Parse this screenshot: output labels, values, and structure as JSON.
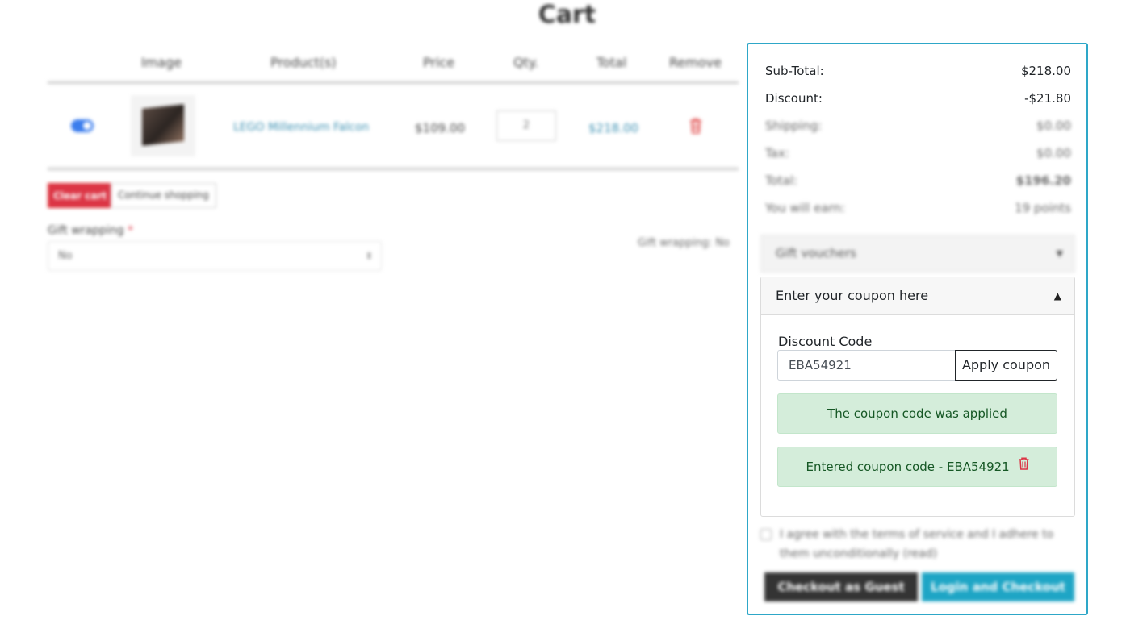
{
  "page": {
    "title": "Cart"
  },
  "table": {
    "headers": [
      "Image",
      "Product(s)",
      "Price",
      "Qty.",
      "Total",
      "Remove"
    ],
    "rows": [
      {
        "product": "LEGO Millennium Falcon",
        "price": "$109.00",
        "qty": "2",
        "total": "$218.00"
      }
    ]
  },
  "actions": {
    "clear_cart": "Clear cart",
    "continue_shopping": "Continue shopping"
  },
  "gift": {
    "label": "Gift wrapping",
    "required_mark": "*",
    "selected": "No",
    "summary": "Gift wrapping: No"
  },
  "totals": {
    "subtotal_label": "Sub-Total:",
    "subtotal_value": "$218.00",
    "discount_label": "Discount:",
    "discount_value": "-$21.80",
    "shipping_label": "Shipping:",
    "shipping_value": "$0.00",
    "tax_label": "Tax:",
    "tax_value": "$0.00",
    "total_label": "Total:",
    "total_value": "$196.20",
    "earn_label": "You will earn:",
    "earn_value": "19 points"
  },
  "vouchers": {
    "label": "Gift vouchers"
  },
  "coupon": {
    "header": "Enter your coupon here",
    "field_label": "Discount Code",
    "code_value": "EBA54921",
    "apply_label": "Apply coupon",
    "applied_message": "The coupon code was applied",
    "entered_message": "Entered coupon code - EBA54921"
  },
  "terms": {
    "text": "I agree with the terms of service and I adhere to them unconditionally (read)"
  },
  "checkout": {
    "guest_label": "Checkout as Guest",
    "login_label": "Login and Checkout"
  },
  "colors": {
    "accent": "#2ea7c8",
    "success_bg": "#d4edda",
    "success_text": "#155724",
    "danger": "#dc3545"
  }
}
